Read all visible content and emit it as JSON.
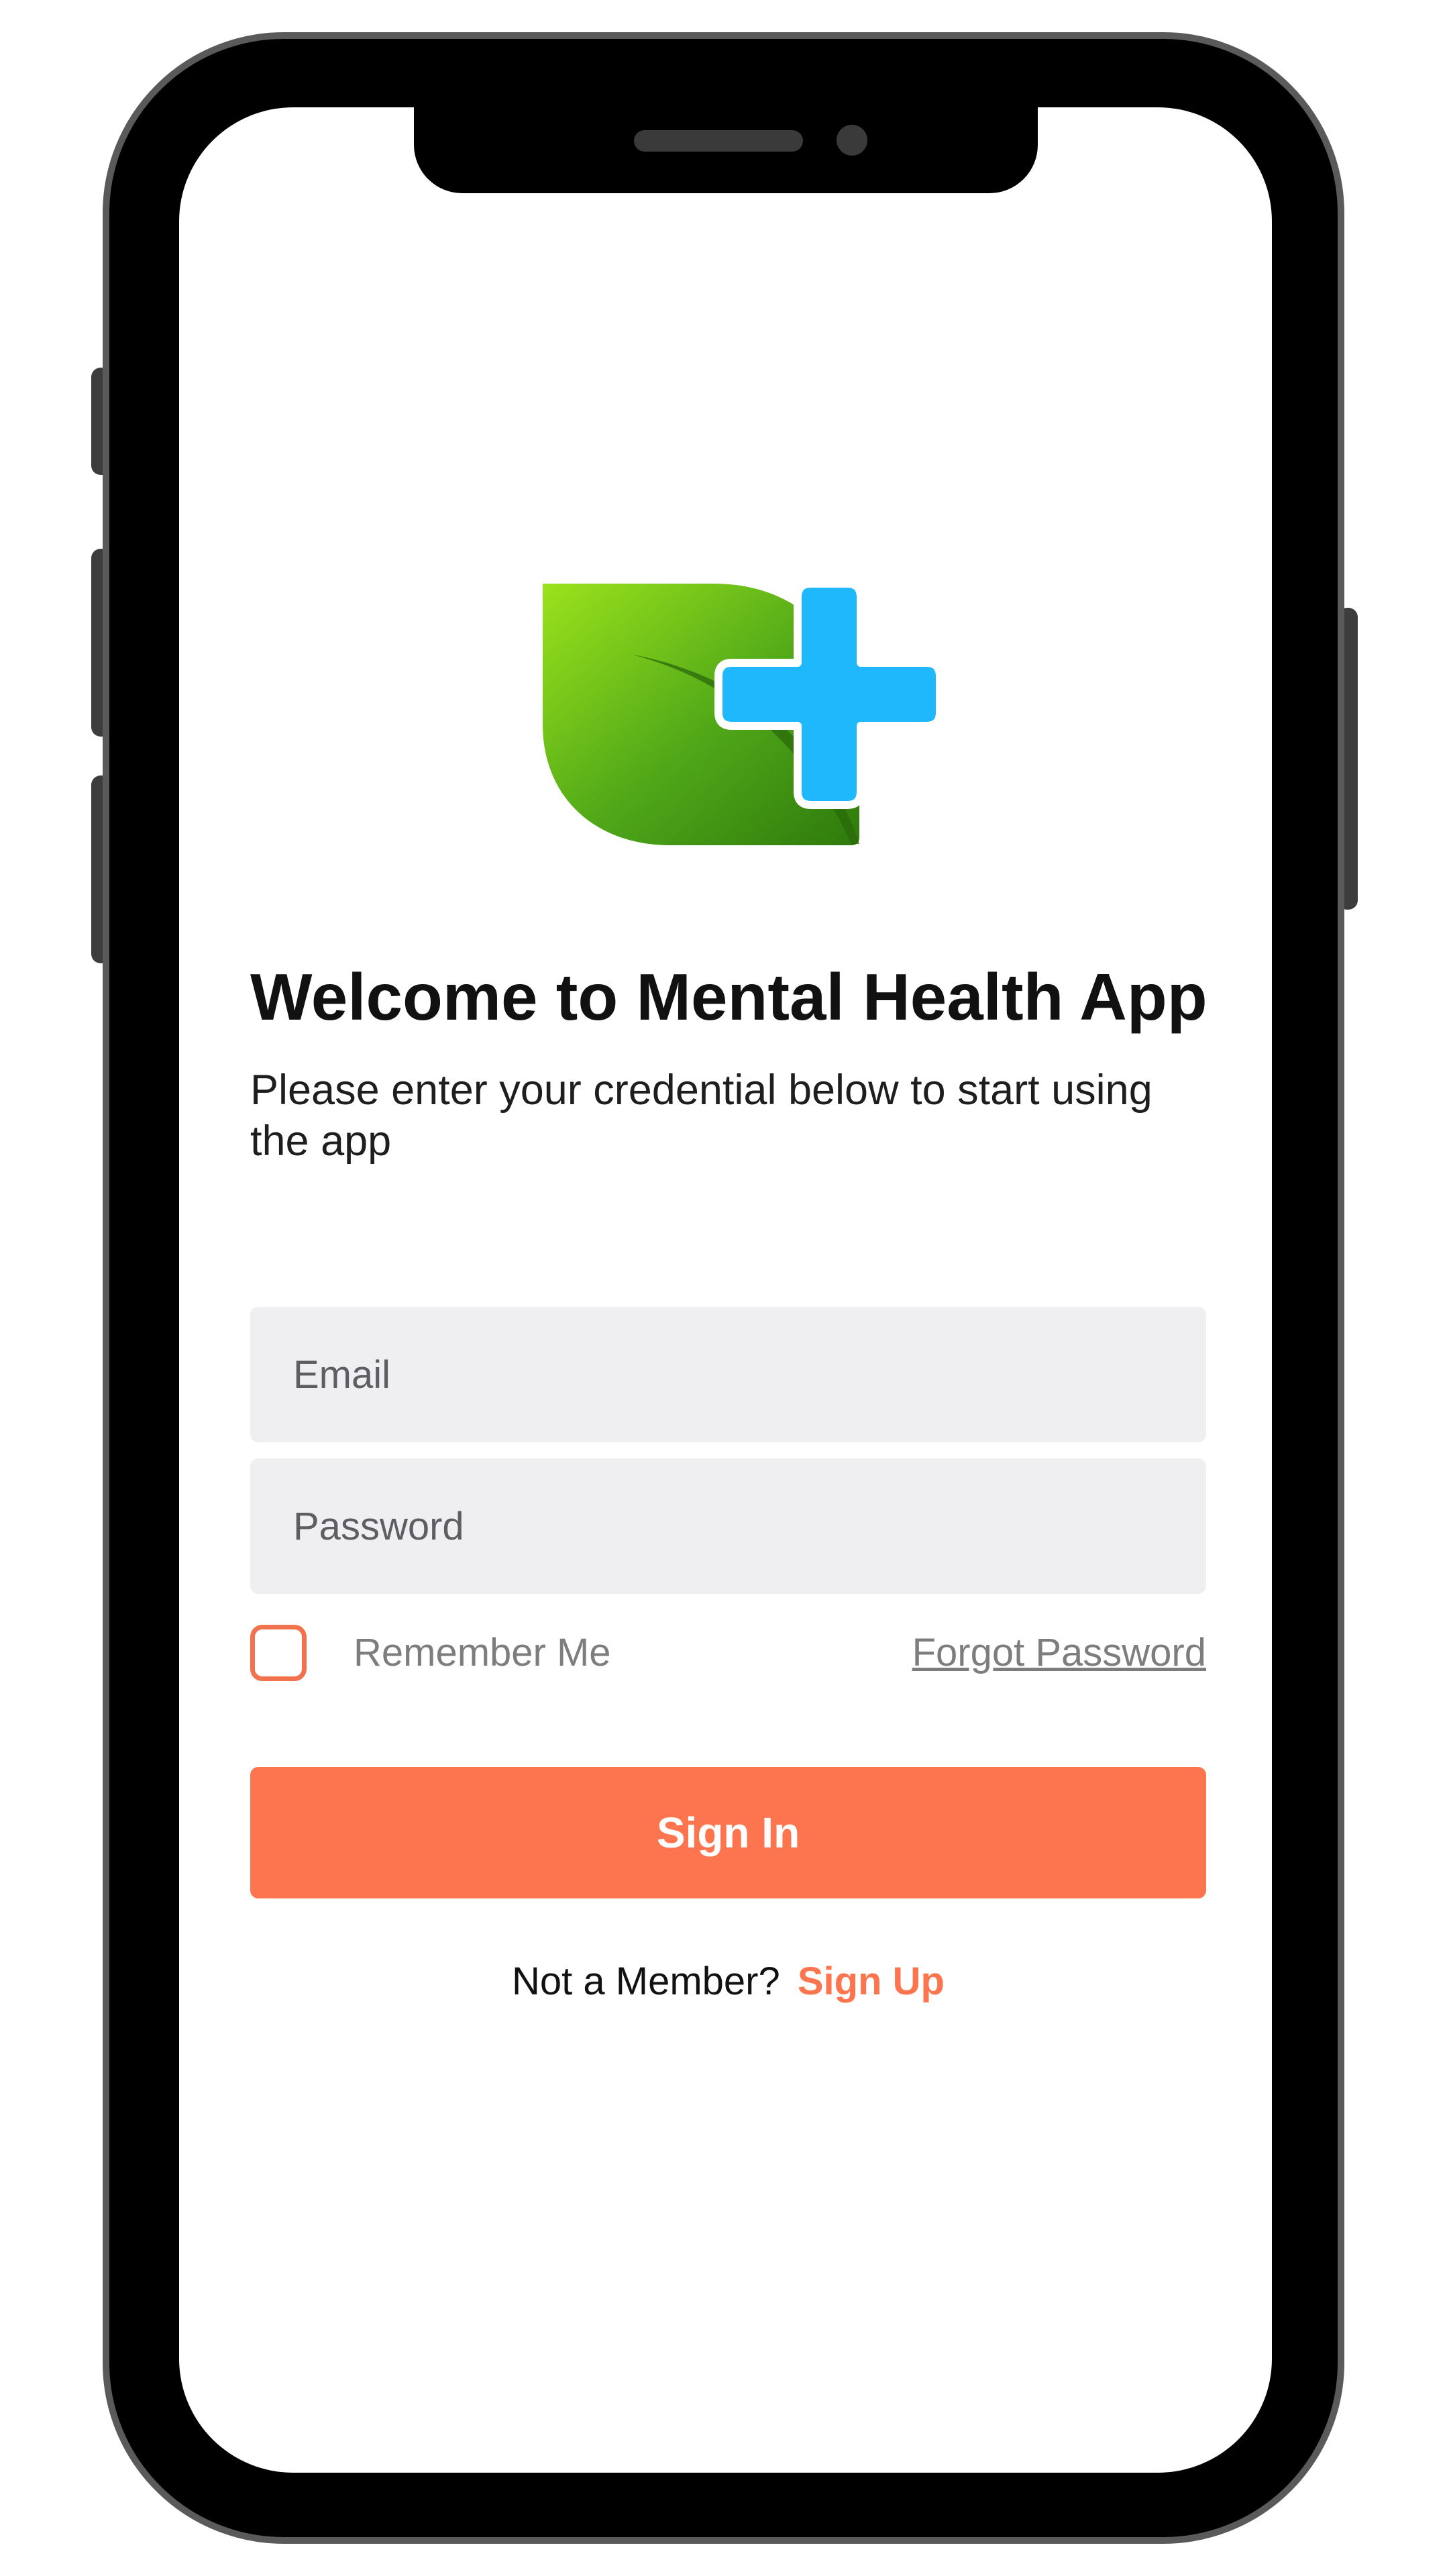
{
  "app": {
    "title": "Welcome to Mental Health App",
    "subtitle": "Please enter your credential below to start using the app"
  },
  "form": {
    "email": {
      "placeholder": "Email",
      "value": ""
    },
    "password": {
      "placeholder": "Password",
      "value": ""
    },
    "remember_label": "Remember Me",
    "remember_checked": false,
    "forgot_label": "Forgot Password",
    "submit_label": "Sign In"
  },
  "footer": {
    "prompt": "Not a Member?",
    "signup_label": "Sign Up"
  },
  "icons": {
    "logo": "leaf-medical-cross-logo",
    "checkbox": "checkbox-unchecked"
  },
  "colors": {
    "accent": "#fd754f",
    "input_background": "#efeff2",
    "logo_green": "#4aa51c",
    "logo_blue": "#1fb8fc",
    "device_frame": "#000000"
  }
}
